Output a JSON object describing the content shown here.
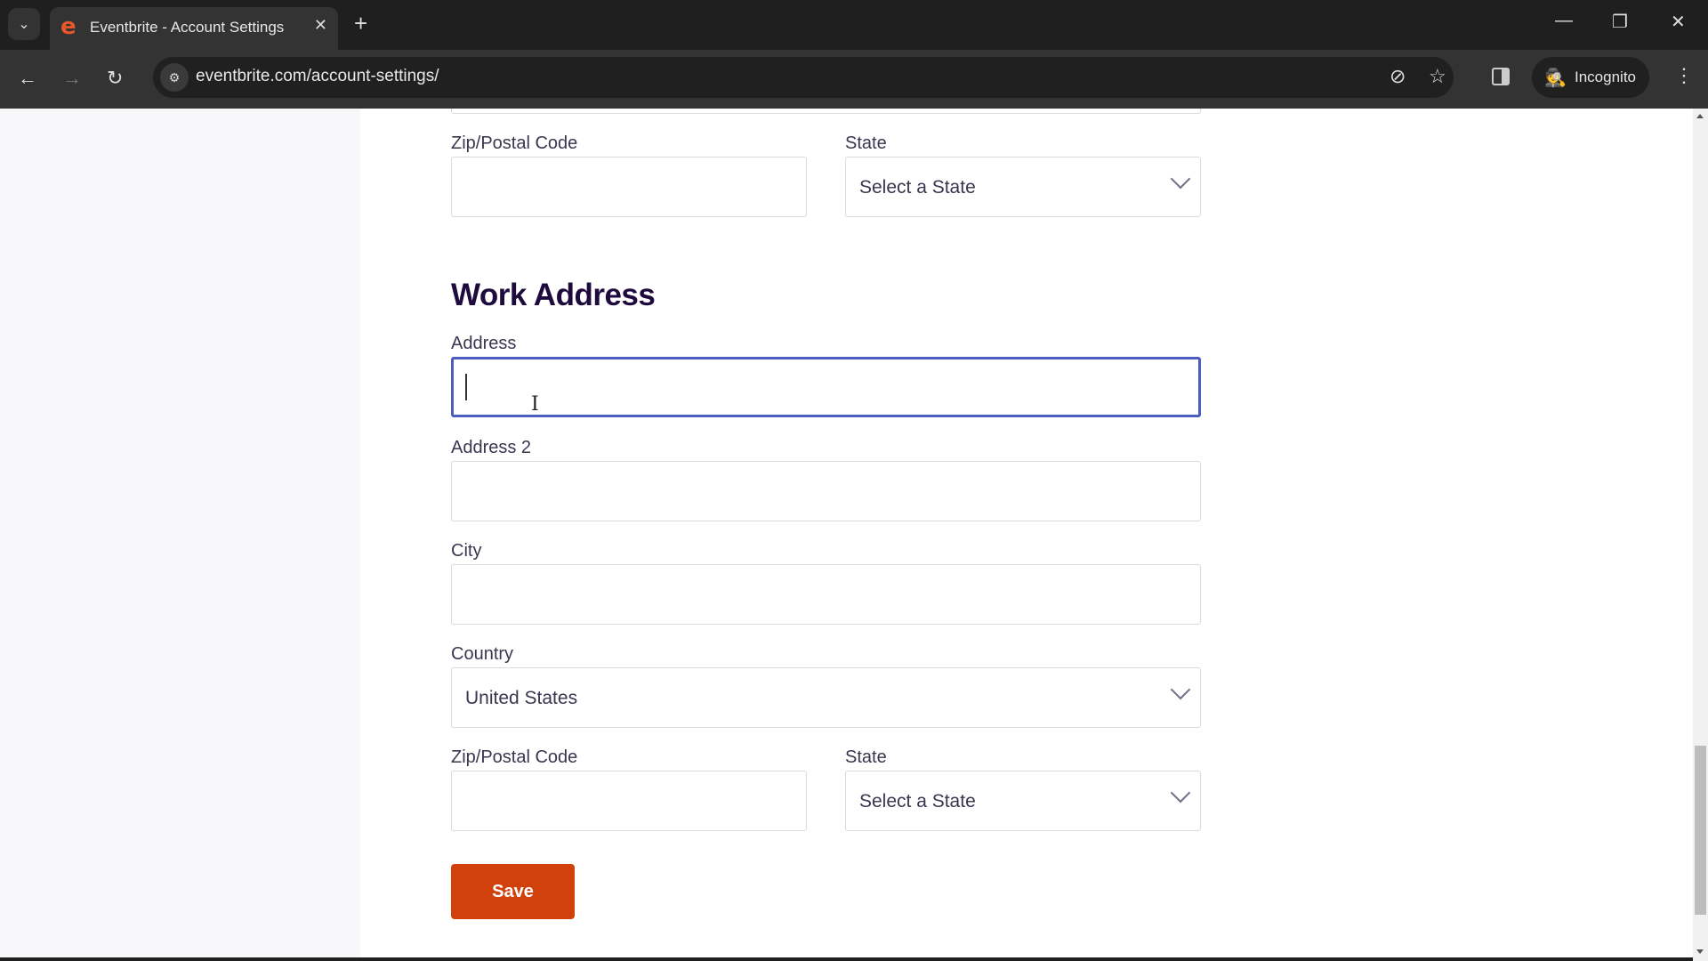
{
  "browser": {
    "tab_title": "Eventbrite - Account Settings",
    "favicon_glyph": "e",
    "new_tab_glyph": "+",
    "tab_close_glyph": "✕",
    "tab_search_glyph": "⌄",
    "url": "eventbrite.com/account-settings/",
    "incognito_label": "Incognito",
    "icons": {
      "back": "←",
      "forward": "→",
      "reload": "↻",
      "site_info": "⚙",
      "eye_off": "⊘",
      "star": "☆",
      "incognito": "🕵",
      "menu": "⋮",
      "minimize": "—",
      "restore": "❐",
      "close": "✕"
    }
  },
  "form": {
    "home": {
      "zip_label": "Zip/Postal Code",
      "zip_value": "",
      "state_label": "State",
      "state_value": "Select a State"
    },
    "work": {
      "title": "Work Address",
      "address_label": "Address",
      "address_value": "",
      "address2_label": "Address 2",
      "address2_value": "",
      "city_label": "City",
      "city_value": "",
      "country_label": "Country",
      "country_value": "United States",
      "zip_label": "Zip/Postal Code",
      "zip_value": "",
      "state_label": "State",
      "state_value": "Select a State"
    },
    "save_label": "Save"
  },
  "colors": {
    "brand_orange": "#d1410c",
    "focus_border": "#4b5dbf",
    "heading": "#1e0a3c"
  }
}
